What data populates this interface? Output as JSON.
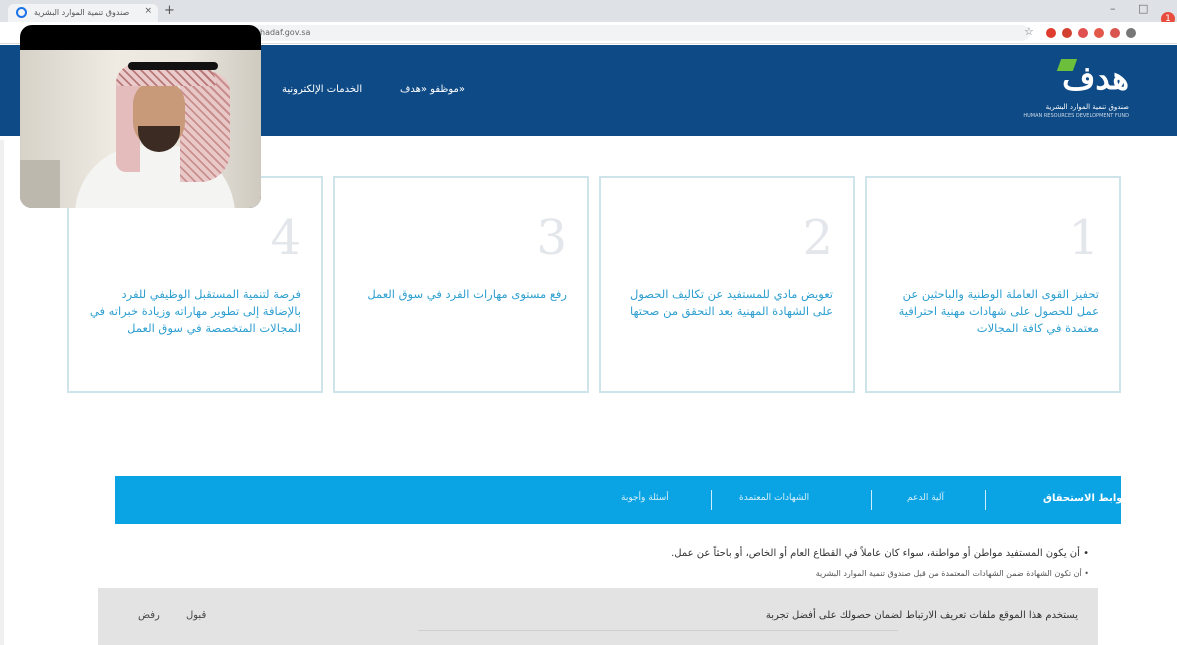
{
  "browser": {
    "tab_title": "صندوق تنمية الموارد البشرية",
    "tab_close": "×",
    "new_tab": "+",
    "url": "hadaf.gov.sa",
    "star": "☆",
    "minimize": "–",
    "maximize": "□",
    "notification_count": "1"
  },
  "site": {
    "logo_text": "هدف",
    "logo_subtitle": "صندوق تنمية الموارد البشرية",
    "logo_subtitle_en": "HUMAN RESOURCES DEVELOPMENT FUND",
    "nav": [
      "موظفو «هدف»",
      "الخدمات الإلكترونية"
    ]
  },
  "cards": [
    {
      "number": "1",
      "text": "تحفيز القوى العاملة الوطنية والباحثين عن عمل للحصول على شهادات مهنية احترافية معتمدة في كافة المجالات"
    },
    {
      "number": "2",
      "text": "تعويض مادي للمستفيد عن تكاليف الحصول على الشهادة المهنية بعد التحقق من صحتها"
    },
    {
      "number": "3",
      "text": "رفع مستوى مهارات الفرد في سوق العمل"
    },
    {
      "number": "4",
      "text": "فرصة لتنمية المستقبل الوظيفي للفرد بالإضافة إلى تطوير مهاراته وزيادة خبراته في المجالات المتخصصة في سوق العمل"
    }
  ],
  "tabs": [
    "ضوابط الاستحقاق",
    "آلية الدعم",
    "الشهادات المعتمدة",
    "أسئلة وأجوبة"
  ],
  "content": {
    "bullet1": "• أن يكون المستفيد مواطن أو مواطنة، سواء كان عاملاً في القطاع العام أو الخاص، أو باحثاً عن عمل.",
    "bullet2": "• أن تكون الشهادة ضمن الشهادات المعتمدة من قبل صندوق تنمية الموارد البشرية"
  },
  "cookie": {
    "text": "يستخدم هذا الموقع ملفات تعريف الارتباط لضمان حصولك على أفضل تجربة",
    "accept": "قبول",
    "reject": "رفض"
  },
  "colors": {
    "header_bg": "#0d4a86",
    "accent": "#0aa3e3",
    "card_text": "#2e9fd0",
    "logo_green": "#6cbf3b"
  }
}
